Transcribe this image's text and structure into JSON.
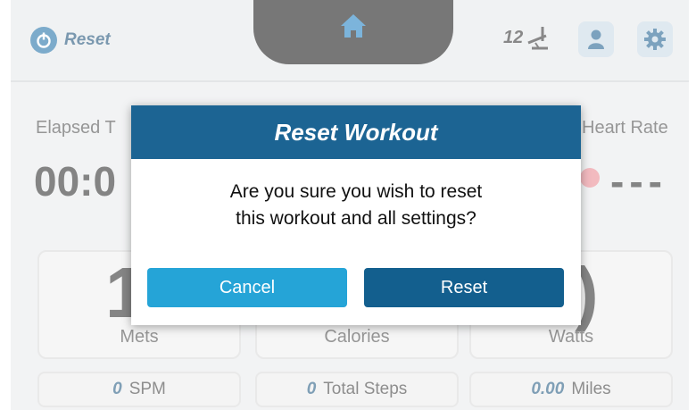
{
  "topbar": {
    "reset_label": "Reset",
    "level_value": "12"
  },
  "stats": {
    "elapsed_label": "Elapsed T",
    "elapsed_value": "00:0",
    "heart_label": "Heart Rate",
    "heart_value": "---"
  },
  "metrics": [
    {
      "big": "1",
      "label": "Mets"
    },
    {
      "big": "",
      "label": "Calories"
    },
    {
      "big": ")",
      "label": "Watts"
    }
  ],
  "footer": [
    {
      "num": "0",
      "text": "SPM"
    },
    {
      "num": "0",
      "text": "Total Steps"
    },
    {
      "num": "0.00",
      "text": "Miles"
    }
  ],
  "dialog": {
    "title": "Reset Workout",
    "message_line1": "Are you sure you wish to reset",
    "message_line2": "this workout and all settings?",
    "cancel_label": "Cancel",
    "reset_label": "Reset"
  },
  "colors": {
    "dialog_header": "#1c6493",
    "cancel_button": "#25a4d7",
    "reset_button": "#135f8e",
    "accent_blue": "#1e6fa5"
  },
  "icons": [
    "reset-icon",
    "home-icon",
    "incline-icon",
    "user-icon",
    "gear-icon"
  ]
}
